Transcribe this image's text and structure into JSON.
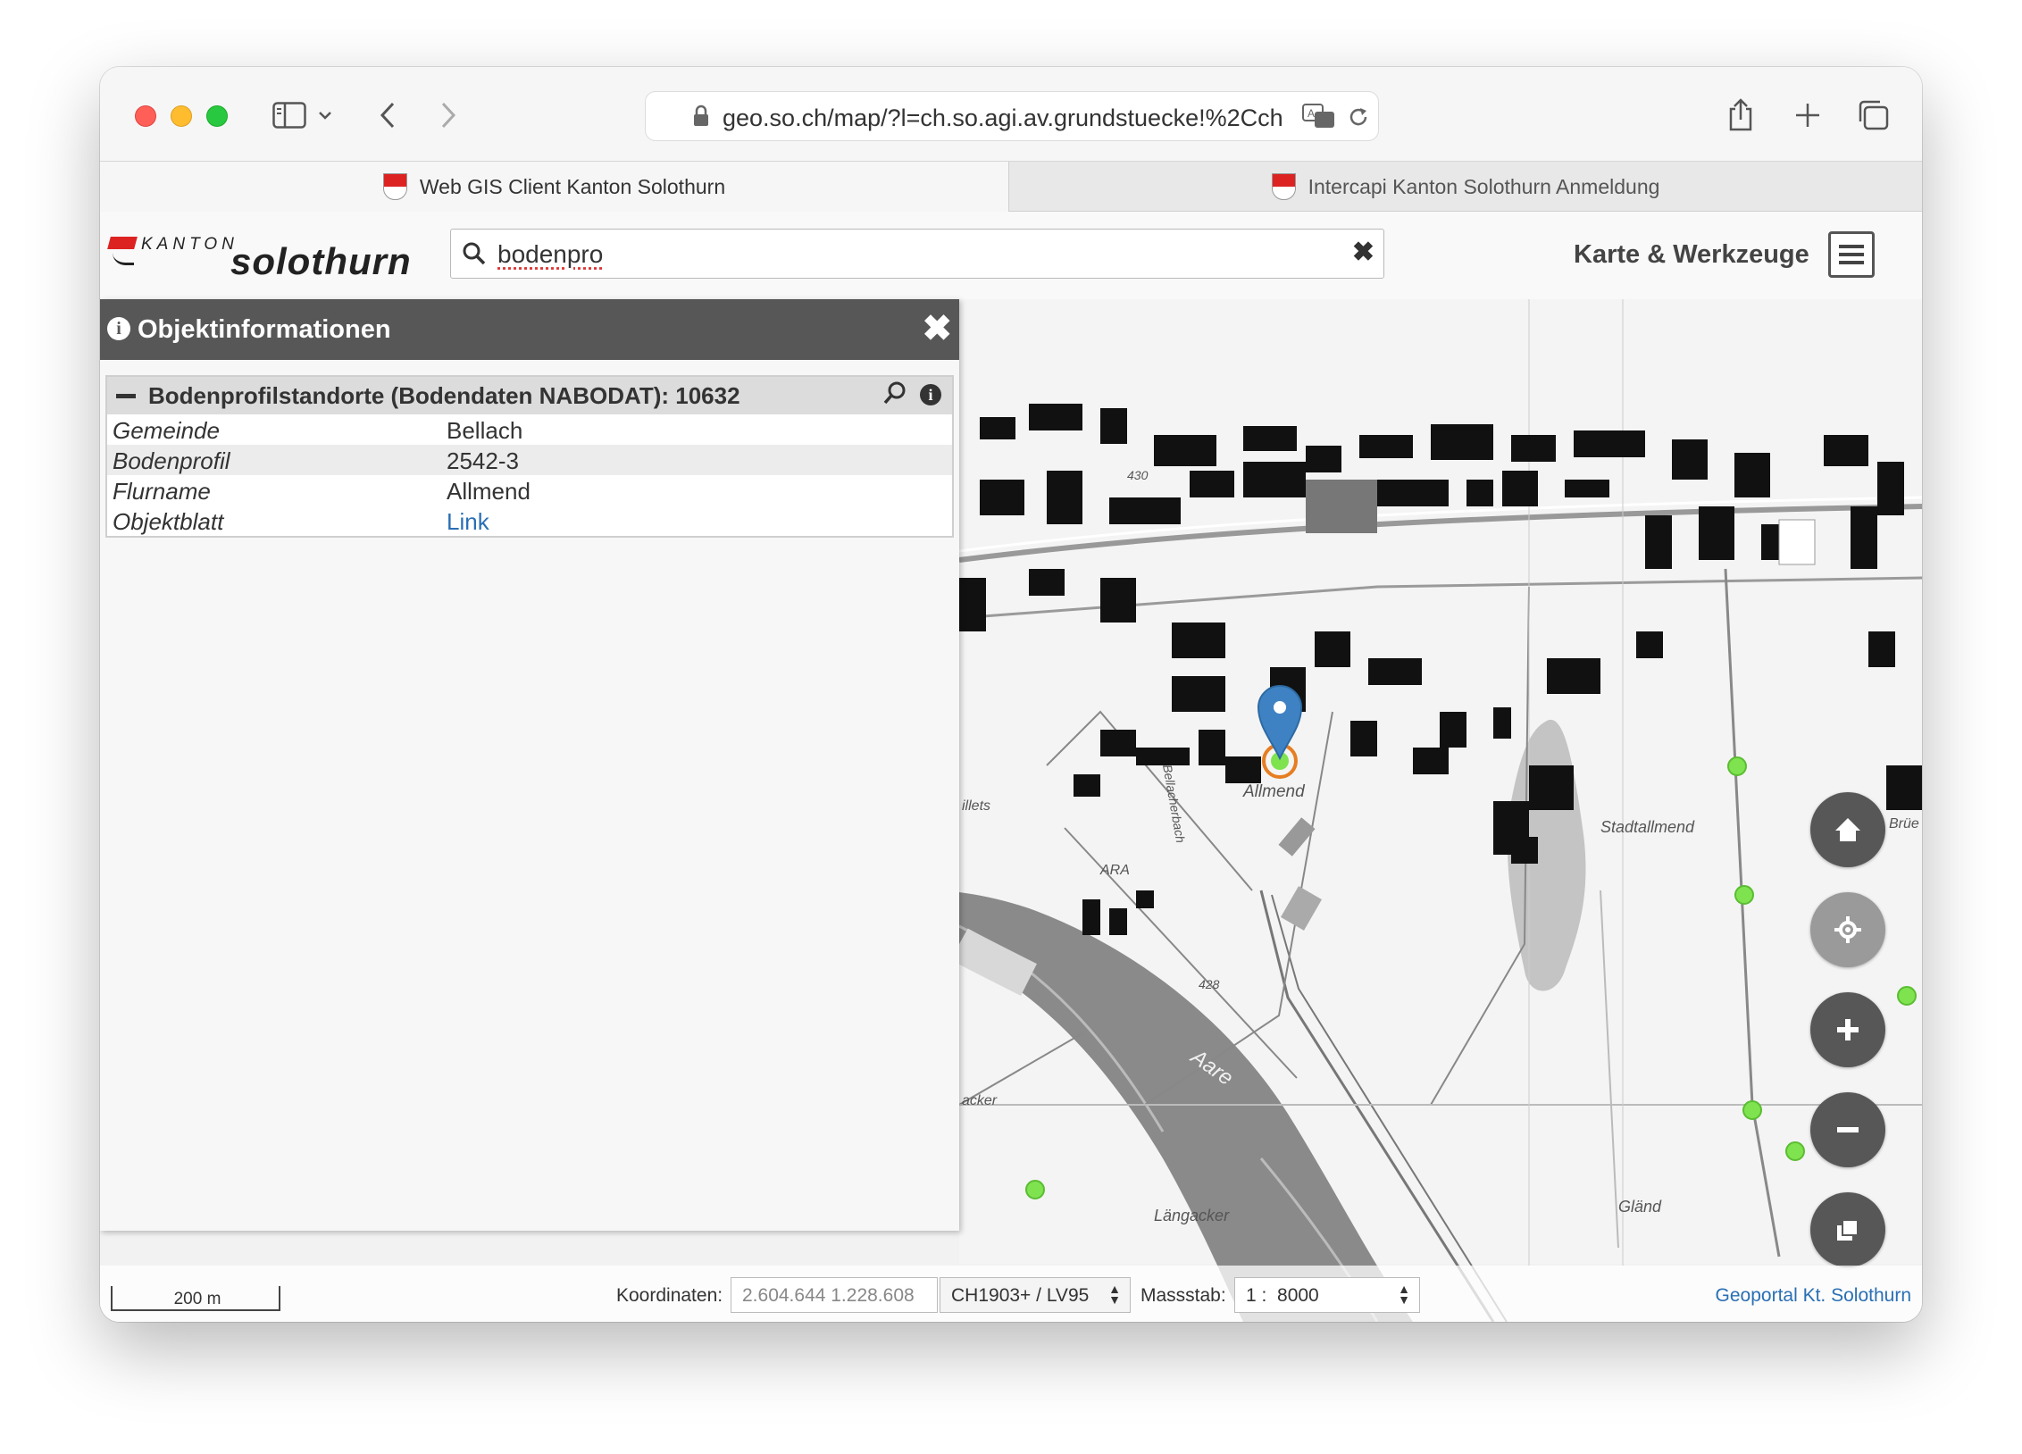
{
  "browser": {
    "url": "geo.so.ch/map/?l=ch.so.agi.av.grundstuecke!%2Cch",
    "tabs": [
      {
        "label": "Web GIS Client Kanton Solothurn",
        "active": true
      },
      {
        "label": "Intercapi Kanton Solothurn Anmeldung",
        "active": false
      }
    ]
  },
  "app": {
    "logo_small": "KANTON",
    "logo_large": "solothurn",
    "search_value": "bodenpro",
    "tools_label": "Karte & Werkzeuge"
  },
  "panel": {
    "title": "Objektinformationen",
    "result_title": "Bodenprofilstandorte (Bodendaten NABODAT): 10632",
    "rows": [
      {
        "key": "Gemeinde",
        "value": "Bellach"
      },
      {
        "key": "Bodenprofil",
        "value": "2542-3"
      },
      {
        "key": "Flurname",
        "value": "Allmend"
      },
      {
        "key": "Objektblatt",
        "value": "Link"
      }
    ]
  },
  "map": {
    "labels": [
      "Allmend",
      "Stadtallmend",
      "ARA",
      "Aare",
      "Längacker",
      "Gländ",
      "428",
      "430",
      "illets",
      "acker",
      "Brüe",
      "Bellacherbach"
    ],
    "marker_color": "#3f82c4",
    "point_color": "#7ee34f"
  },
  "controls": [
    "home-icon",
    "locate-icon",
    "zoom-in-icon",
    "zoom-out-icon",
    "layers-icon"
  ],
  "bottom": {
    "scale_label": "200 m",
    "coord_label": "Koordinaten:",
    "coord_value": "2.604.644 1.228.608",
    "crs_value": "CH1903+ / LV95",
    "scale_label_text": "Massstab:",
    "scale_value": "1 :  8000",
    "geoportal_link": "Geoportal Kt. Solothurn"
  }
}
